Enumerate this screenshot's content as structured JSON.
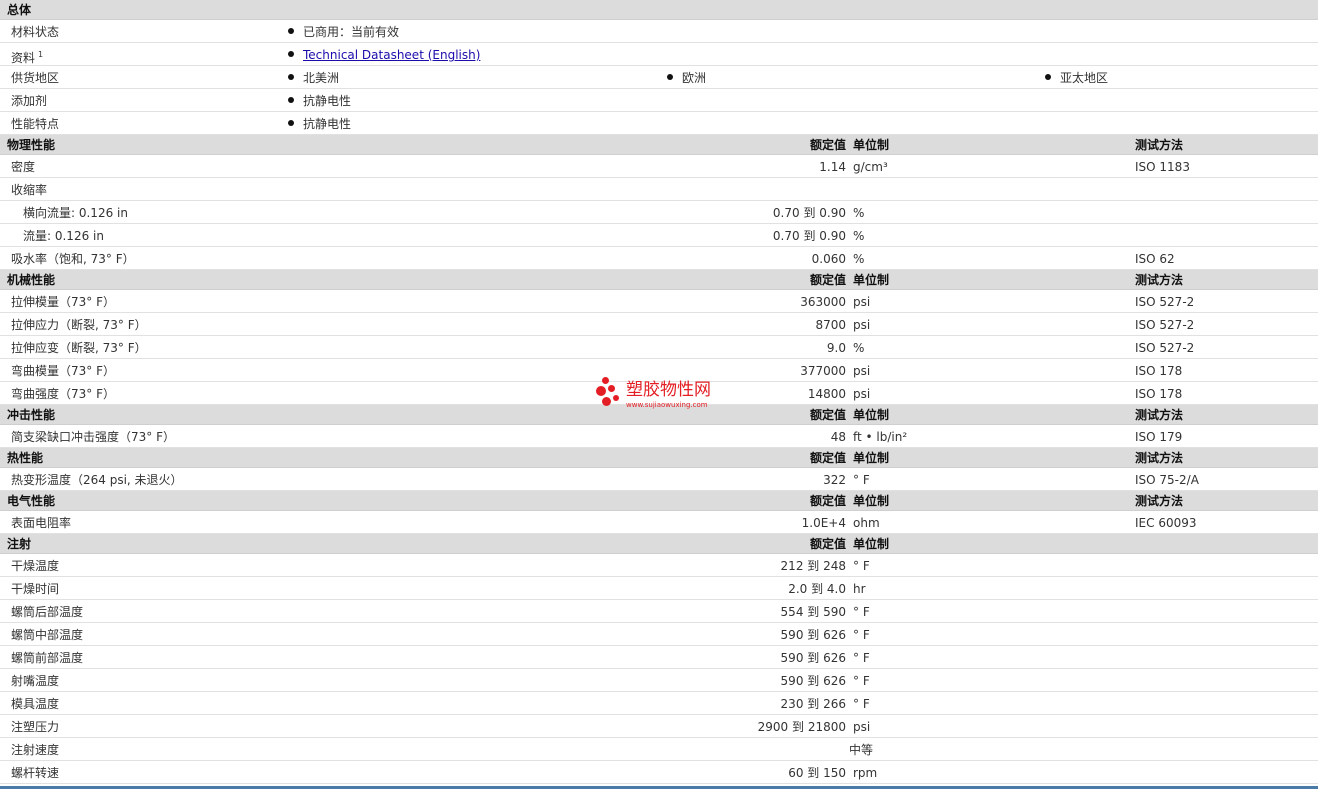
{
  "general": {
    "title": "总体",
    "rows": [
      {
        "label": "材料状态",
        "items": [
          "已商用：当前有效"
        ]
      },
      {
        "label": "资料",
        "sup": "1",
        "items": [
          "Technical Datasheet (English)"
        ],
        "link": true
      },
      {
        "label": "供货地区",
        "items": [
          "北美洲",
          "欧洲",
          "亚太地区"
        ]
      },
      {
        "label": "添加剂",
        "items": [
          "抗静电性"
        ]
      },
      {
        "label": "性能特点",
        "items": [
          "抗静电性"
        ]
      }
    ]
  },
  "columns": {
    "value": "额定值",
    "unit": "单位制",
    "method": "测试方法"
  },
  "sections": [
    {
      "title": "物理性能",
      "show_method": true,
      "rows": [
        {
          "label": "密度",
          "value": "1.14",
          "unit": "g/cm³",
          "method": "ISO 1183"
        },
        {
          "label": "收缩率",
          "value": "",
          "unit": "",
          "method": ""
        },
        {
          "label": "横向流量: 0.126 in",
          "sub": true,
          "value": "0.70 到  0.90",
          "unit": "%",
          "method": ""
        },
        {
          "label": "流量: 0.126 in",
          "sub": true,
          "value": "0.70 到  0.90",
          "unit": "%",
          "method": ""
        },
        {
          "label": "吸水率（饱和, 73° F）",
          "value": "0.060",
          "unit": "%",
          "method": "ISO 62"
        }
      ]
    },
    {
      "title": "机械性能",
      "show_method": true,
      "rows": [
        {
          "label": "拉伸模量（73° F）",
          "value": "363000",
          "unit": "psi",
          "method": "ISO 527-2"
        },
        {
          "label": "拉伸应力（断裂, 73° F）",
          "value": "8700",
          "unit": "psi",
          "method": "ISO 527-2"
        },
        {
          "label": "拉伸应变（断裂, 73° F）",
          "value": "9.0",
          "unit": "%",
          "method": "ISO 527-2"
        },
        {
          "label": "弯曲模量（73° F）",
          "value": "377000",
          "unit": "psi",
          "method": "ISO 178"
        },
        {
          "label": "弯曲强度（73° F）",
          "value": "14800",
          "unit": "psi",
          "method": "ISO 178"
        }
      ]
    },
    {
      "title": "冲击性能",
      "show_method": true,
      "rows": [
        {
          "label": "简支梁缺口冲击强度（73° F）",
          "value": "48",
          "unit": "ft • lb/in²",
          "method": "ISO 179"
        }
      ]
    },
    {
      "title": "热性能",
      "show_method": true,
      "rows": [
        {
          "label": "热变形温度（264 psi, 未退火）",
          "value": "322",
          "unit": "° F",
          "method": "ISO 75-2/A"
        }
      ]
    },
    {
      "title": "电气性能",
      "show_method": true,
      "rows": [
        {
          "label": "表面电阻率",
          "value": "1.0E+4",
          "unit": "ohm",
          "method": "IEC 60093"
        }
      ]
    },
    {
      "title": "注射",
      "show_method": false,
      "rows": [
        {
          "label": "干燥温度",
          "value": "212 到  248",
          "unit": "° F",
          "method": ""
        },
        {
          "label": "干燥时间",
          "value": "2.0 到  4.0",
          "unit": "hr",
          "method": ""
        },
        {
          "label": "螺筒后部温度",
          "value": "554 到  590",
          "unit": "° F",
          "method": ""
        },
        {
          "label": "螺筒中部温度",
          "value": "590 到  626",
          "unit": "° F",
          "method": ""
        },
        {
          "label": "螺筒前部温度",
          "value": "590 到  626",
          "unit": "° F",
          "method": ""
        },
        {
          "label": "射嘴温度",
          "value": "590 到  626",
          "unit": "° F",
          "method": ""
        },
        {
          "label": "模具温度",
          "value": "230 到  266",
          "unit": "° F",
          "method": ""
        },
        {
          "label": "注塑压力",
          "value": "2900 到  21800",
          "unit": "psi",
          "method": ""
        },
        {
          "label": "注射速度",
          "value": "中等",
          "unit": "",
          "method": "",
          "mid": true
        },
        {
          "label": "螺杆转速",
          "value": "60 到  150",
          "unit": "rpm",
          "method": ""
        }
      ]
    }
  ],
  "watermark": {
    "name": "塑胶物性网",
    "url": "www.sujiaowuxing.com"
  },
  "colors": {
    "header_bg": "#dcdcdc",
    "link": "#1a0dab",
    "watermark": "#e31e24"
  }
}
